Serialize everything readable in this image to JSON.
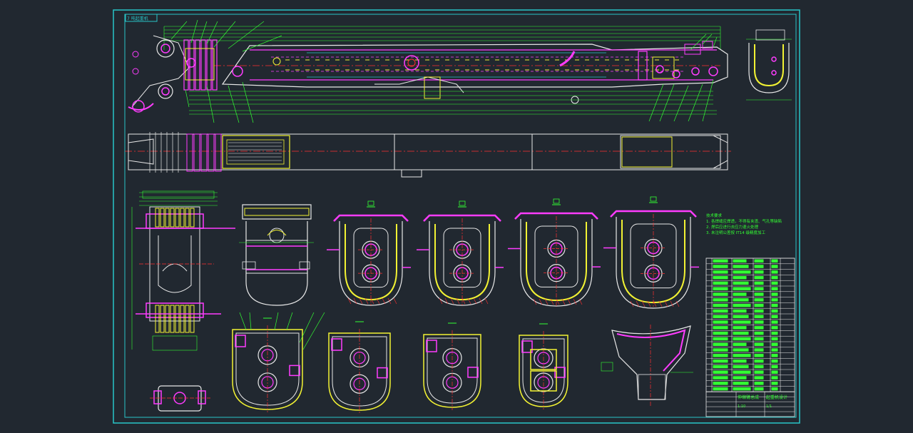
{
  "colors": {
    "background": "#212830",
    "frame": "#29c5c8",
    "white": "#e8e8e8",
    "yellow": "#f2f233",
    "magenta": "#ff3cff",
    "red": "#ff3030",
    "green": "#33ff33",
    "cyan": "#29c5c8",
    "orange": "#ff9a2a"
  },
  "drawing": {
    "title_tag": "7 吨起重机",
    "notes": [
      "技术要求",
      "1. 各焊缝应焊透，不得有夹渣、气孔等缺陷",
      "2. 焊后应进行去应力退火处理",
      "3. 未注明公差按 IT14 级精度加工"
    ]
  },
  "title_block": {
    "drawing_name": "伸缩臂总成",
    "company": "起重机设计",
    "scale": "1:10",
    "sheet": "1/1"
  },
  "parts_list_rows": 24
}
